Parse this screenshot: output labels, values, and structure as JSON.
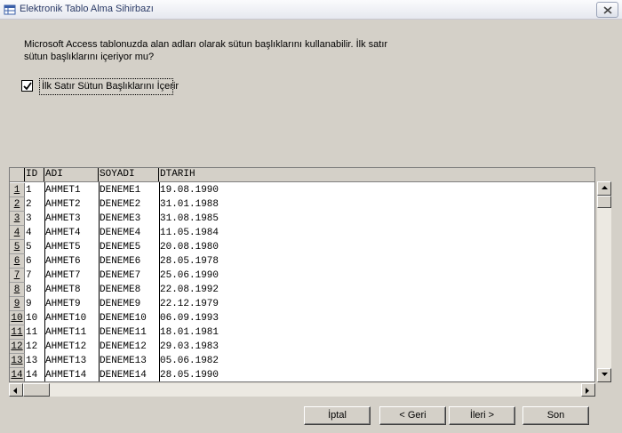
{
  "window": {
    "title": "Elektronik Tablo Alma Sihirbazı"
  },
  "description": "Microsoft Access tablonuzda alan adları olarak sütun başlıklarını kullanabilir. İlk satır sütun başlıklarını içeriyor mu?",
  "checkbox": {
    "label": "İlk Satır Sütun Başlıklarını İçerir",
    "checked": true
  },
  "table": {
    "columns": [
      "ID",
      "ADI",
      "SOYADI",
      "DTARIH"
    ],
    "rows": [
      [
        "1",
        "1",
        "AHMET1",
        "DENEME1",
        "19.08.1990"
      ],
      [
        "2",
        "2",
        "AHMET2",
        "DENEME2",
        "31.01.1988"
      ],
      [
        "3",
        "3",
        "AHMET3",
        "DENEME3",
        "31.08.1985"
      ],
      [
        "4",
        "4",
        "AHMET4",
        "DENEME4",
        "11.05.1984"
      ],
      [
        "5",
        "5",
        "AHMET5",
        "DENEME5",
        "20.08.1980"
      ],
      [
        "6",
        "6",
        "AHMET6",
        "DENEME6",
        "28.05.1978"
      ],
      [
        "7",
        "7",
        "AHMET7",
        "DENEME7",
        "25.06.1990"
      ],
      [
        "8",
        "8",
        "AHMET8",
        "DENEME8",
        "22.08.1992"
      ],
      [
        "9",
        "9",
        "AHMET9",
        "DENEME9",
        "22.12.1979"
      ],
      [
        "10",
        "10",
        "AHMET10",
        "DENEME10",
        "06.09.1993"
      ],
      [
        "11",
        "11",
        "AHMET11",
        "DENEME11",
        "18.01.1981"
      ],
      [
        "12",
        "12",
        "AHMET12",
        "DENEME12",
        "29.03.1983"
      ],
      [
        "13",
        "13",
        "AHMET13",
        "DENEME13",
        "05.06.1982"
      ],
      [
        "14",
        "14",
        "AHMET14",
        "DENEME14",
        "28.05.1990"
      ]
    ]
  },
  "buttons": {
    "cancel": "İptal",
    "back": "< Geri",
    "next": "İleri >",
    "finish": "Son"
  },
  "icons": {
    "app": "access-wizard-icon",
    "close": "close-icon"
  },
  "colors": {
    "dialog_bg": "#d4d0c8",
    "title_text": "#2a3a66"
  }
}
